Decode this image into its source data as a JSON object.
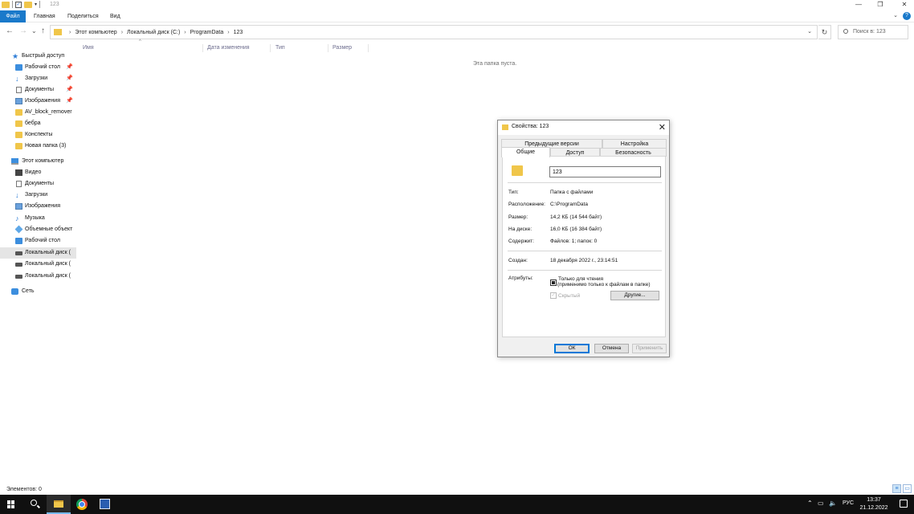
{
  "window": {
    "title": "123",
    "minimize": "—",
    "maximize": "❐",
    "close": "✕"
  },
  "ribbon": {
    "tabs": [
      "Файл",
      "Главная",
      "Поделиться",
      "Вид"
    ]
  },
  "nav": {
    "back": "←",
    "forward": "→",
    "recent": "⌄",
    "up": "↑",
    "breadcrumbs": [
      "Этот компьютер",
      "Локальный диск (C:)",
      "ProgramData",
      "123"
    ],
    "search_placeholder": "Поиск в: 123"
  },
  "sidebar": {
    "items": [
      {
        "label": "Быстрый доступ",
        "icon": "star-icon"
      },
      {
        "label": "Рабочий стол",
        "icon": "desktop-icon",
        "pinned": true
      },
      {
        "label": "Загрузки",
        "icon": "downloads-icon",
        "pinned": true
      },
      {
        "label": "Документы",
        "icon": "documents-icon",
        "pinned": true
      },
      {
        "label": "Изображения",
        "icon": "pictures-icon",
        "pinned": true
      },
      {
        "label": "AV_block_remover",
        "icon": "folder-icon"
      },
      {
        "label": "бебра",
        "icon": "folder-icon"
      },
      {
        "label": "Конспекты",
        "icon": "folder-icon"
      },
      {
        "label": "Новая папка (3)",
        "icon": "folder-icon"
      },
      {
        "label": "Этот компьютер",
        "icon": "computer-icon"
      },
      {
        "label": "Видео",
        "icon": "video-icon"
      },
      {
        "label": "Документы",
        "icon": "documents-icon"
      },
      {
        "label": "Загрузки",
        "icon": "downloads-icon"
      },
      {
        "label": "Изображения",
        "icon": "pictures-icon"
      },
      {
        "label": "Музыка",
        "icon": "music-icon"
      },
      {
        "label": "Объемные объект",
        "icon": "3d-objects-icon"
      },
      {
        "label": "Рабочий стол",
        "icon": "desktop-icon"
      },
      {
        "label": "Локальный диск (",
        "icon": "disk-icon",
        "selected": true
      },
      {
        "label": "Локальный диск (",
        "icon": "disk-icon"
      },
      {
        "label": "Локальный диск (",
        "icon": "disk-icon"
      },
      {
        "label": "Сеть",
        "icon": "network-icon"
      }
    ]
  },
  "content": {
    "columns": [
      "Имя",
      "Дата изменения",
      "Тип",
      "Размер"
    ],
    "empty_message": "Эта папка пуста."
  },
  "status": {
    "items_count": "Элементов: 0"
  },
  "dialog": {
    "title": "Свойства: 123",
    "tabs_top": [
      "Предыдущие версии",
      "Настройка"
    ],
    "tabs_bottom": [
      "Общие",
      "Доступ",
      "Безопасность"
    ],
    "active_tab": "Общие",
    "name_value": "123",
    "props": [
      {
        "label": "Тип:",
        "value": "Папка с файлами"
      },
      {
        "label": "Расположение:",
        "value": "C:\\ProgramData"
      },
      {
        "label": "Размер:",
        "value": "14,2 КБ (14 544 байт)"
      },
      {
        "label": "На диске:",
        "value": "16,0 КБ (16 384 байт)"
      },
      {
        "label": "Содержит:",
        "value": "Файлов: 1; папок: 0"
      }
    ],
    "created_label": "Создан:",
    "created_value": "18 декабря 2022 г., 23:14:51",
    "attributes_label": "Атрибуты:",
    "readonly_label": "Только для чтения",
    "readonly_note": "(применимо только к файлам в папке)",
    "hidden_label": "Скрытый",
    "other_button": "Другие...",
    "ok_button": "ОК",
    "cancel_button": "Отмена",
    "apply_button": "Применить"
  },
  "taskbar": {
    "language": "РУС",
    "time": "13:37",
    "date": "21.12.2022"
  },
  "colors": {
    "accent": "#1979ca",
    "folder": "#f0c64a",
    "taskbar": "#101010"
  }
}
